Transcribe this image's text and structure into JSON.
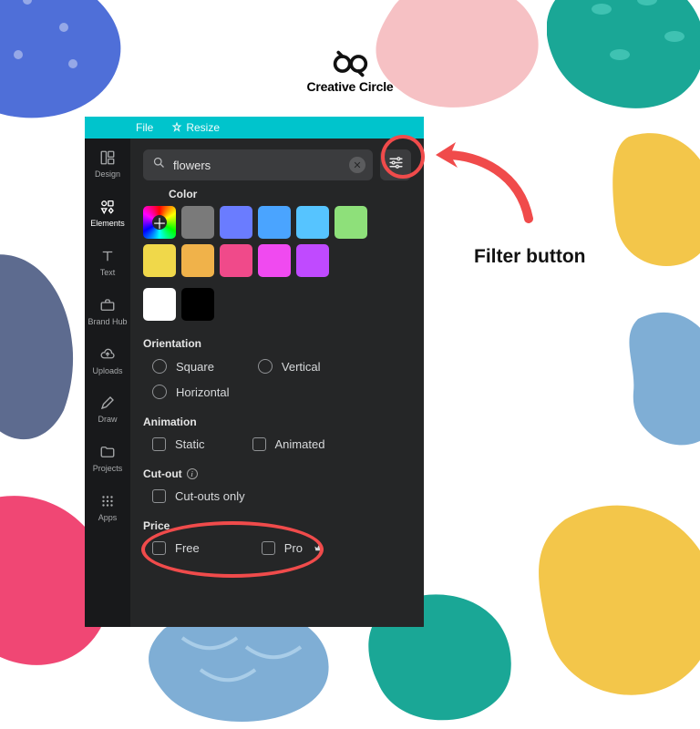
{
  "brand": {
    "name": "Creative Circle"
  },
  "topbar": {
    "file": "File",
    "resize": "Resize"
  },
  "sidebar": {
    "items": [
      {
        "label": "Design"
      },
      {
        "label": "Elements"
      },
      {
        "label": "Text"
      },
      {
        "label": "Brand Hub"
      },
      {
        "label": "Uploads"
      },
      {
        "label": "Draw"
      },
      {
        "label": "Projects"
      },
      {
        "label": "Apps"
      }
    ]
  },
  "search": {
    "value": "flowers"
  },
  "filters": {
    "color_label": "Color",
    "swatches": [
      "#7a7a7a",
      "#6a7cff",
      "#4aa4ff",
      "#56c4ff",
      "#8ee07a",
      "#f0d84a",
      "#f0b24a",
      "#f04a8a",
      "#f04af0",
      "#c04aff"
    ],
    "extra_swatches": [
      "#ffffff",
      "#000000"
    ],
    "orientation": {
      "label": "Orientation",
      "square": "Square",
      "vertical": "Vertical",
      "horizontal": "Horizontal"
    },
    "animation": {
      "label": "Animation",
      "static": "Static",
      "animated": "Animated"
    },
    "cutout": {
      "label": "Cut-out",
      "only": "Cut-outs only"
    },
    "price": {
      "label": "Price",
      "free": "Free",
      "pro": "Pro"
    }
  },
  "callout": {
    "filter_button": "Filter button"
  },
  "colors": {
    "accent": "#00c4cc",
    "marker": "#f04b4b"
  }
}
